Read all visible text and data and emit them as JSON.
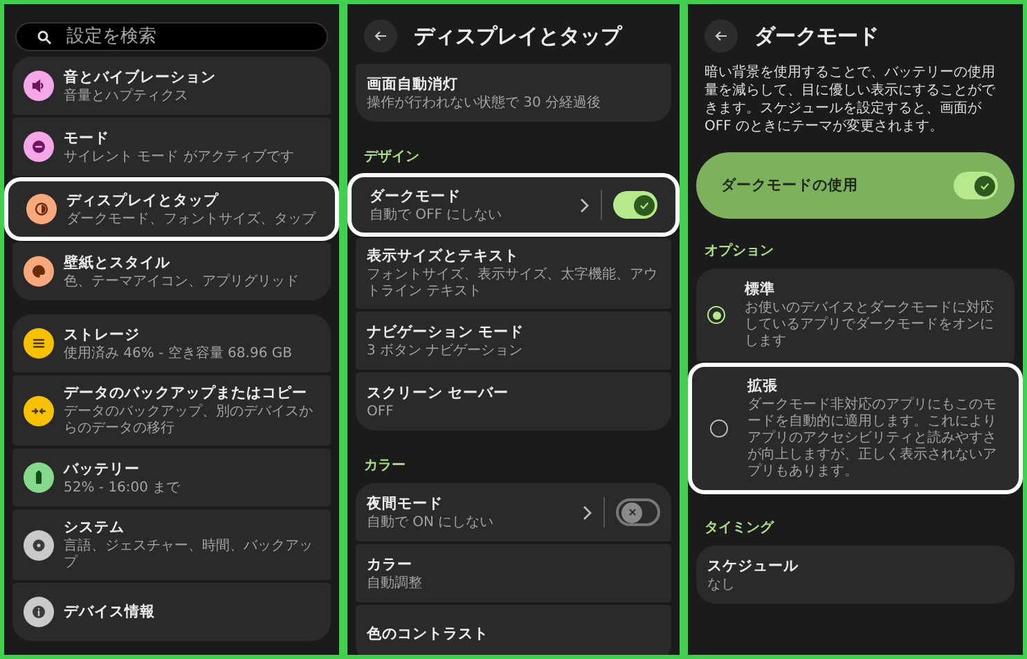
{
  "panels": [
    {
      "kind": "home",
      "search": {
        "placeholder": "設定を検索"
      },
      "groups": [
        [
          {
            "title": "音とバイブレーション",
            "subtitle": "音量とハプティクス",
            "color": "#f4a6e6",
            "highlighted": false
          },
          {
            "title": "モード",
            "subtitle": "サイレント モード がアクティブです",
            "color": "#f4a6e6",
            "highlighted": false
          },
          {
            "title": "ディスプレイとタップ",
            "subtitle": "ダークモード、フォントサイズ、タップ",
            "color": "#f7a97c",
            "highlighted": true
          },
          {
            "title": "壁紙とスタイル",
            "subtitle": "色、テーマアイコン、アプリグリッド",
            "color": "#f7a97c",
            "highlighted": false
          }
        ],
        [
          {
            "title": "ストレージ",
            "subtitle": "使用済み 46% - 空き容量 68.96 GB",
            "color": "#f6c100",
            "highlighted": false
          },
          {
            "title": "データのバックアップまたはコピー",
            "subtitle": "データのバックアップ、別のデバイスからのデータの移行",
            "color": "#f6c100",
            "highlighted": false
          },
          {
            "title": "バッテリー",
            "subtitle": "52% - 16:00 まで",
            "color": "#84d98c",
            "highlighted": false
          },
          {
            "title": "システム",
            "subtitle": "言語、ジェスチャー、時間、バックアップ",
            "color": "#c9c9c9",
            "highlighted": false
          },
          {
            "title": "デバイス情報",
            "color": "#c9c9c9",
            "highlighted": false
          }
        ]
      ]
    },
    {
      "kind": "list",
      "title": "ディスプレイとタップ",
      "sections": [
        {
          "items": [
            {
              "kind": "link",
              "title": "画面自動消灯",
              "subtitle": "操作が行われない状態で 30 分経過後",
              "highlighted": false
            }
          ]
        },
        {
          "header": "デザイン",
          "items": [
            {
              "kind": "toggle",
              "title": "ダークモード",
              "subtitle": "自動で OFF にしない",
              "on": true,
              "highlighted": true
            },
            {
              "kind": "link",
              "title": "表示サイズとテキスト",
              "subtitle": "フォントサイズ、表示サイズ、太字機能、アウトライン テキスト",
              "highlighted": false
            },
            {
              "kind": "link",
              "title": "ナビゲーション モード",
              "subtitle": "3 ボタン ナビゲーション",
              "highlighted": false
            },
            {
              "kind": "link",
              "title": "スクリーン セーバー",
              "subtitle": "OFF",
              "highlighted": false
            }
          ]
        },
        {
          "header": "カラー",
          "items": [
            {
              "kind": "toggle",
              "title": "夜間モード",
              "subtitle": "自動で ON にしない",
              "on": false,
              "highlighted": false
            },
            {
              "kind": "link",
              "title": "カラー",
              "subtitle": "自動調整",
              "highlighted": false
            },
            {
              "kind": "link",
              "title": "色のコントラスト",
              "highlighted": false
            }
          ]
        }
      ]
    },
    {
      "kind": "detail",
      "title": "ダークモード",
      "description": "暗い背景を使用することで、バッテリーの使用量を減らして、目に優しい表示にすることができます。スケジュールを設定すると、画面が OFF のときにテーマが変更されます。",
      "main_toggle": {
        "label": "ダークモードの使用",
        "on": true
      },
      "options": {
        "header": "オプション",
        "items": [
          {
            "title": "標準",
            "subtitle": "お使いのデバイスとダークモードに対応しているアプリでダークモードをオンにします",
            "selected": true,
            "highlighted": false
          },
          {
            "title": "拡張",
            "subtitle": "ダークモード非対応のアプリにもこのモードを自動的に適用します。これによりアプリのアクセシビリティと読みやすさが向上しますが、正しく表示されないアプリもあります。",
            "selected": false,
            "highlighted": true
          }
        ]
      },
      "timing": {
        "header": "タイミング",
        "items": [
          {
            "title": "スケジュール",
            "subtitle": "なし"
          }
        ]
      }
    }
  ]
}
